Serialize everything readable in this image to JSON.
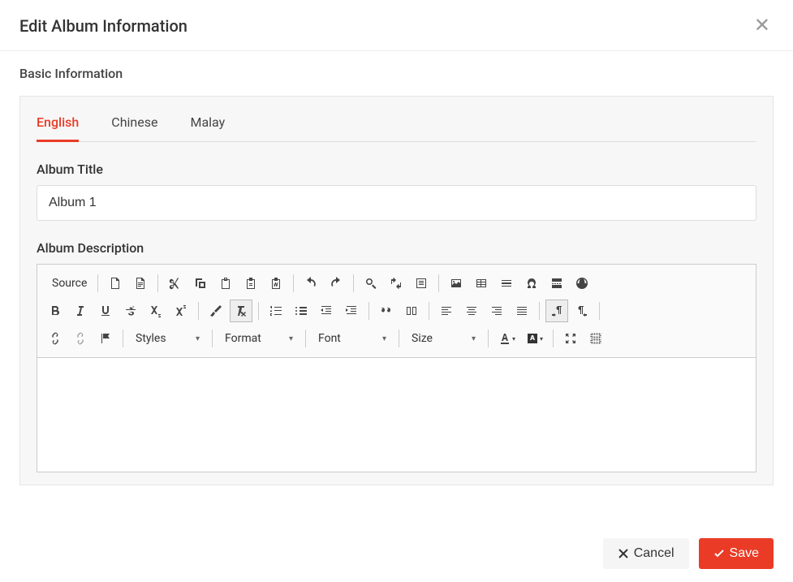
{
  "header": {
    "title": "Edit Album Information"
  },
  "section": {
    "title": "Basic Information"
  },
  "tabs": {
    "english": "English",
    "chinese": "Chinese",
    "malay": "Malay"
  },
  "fields": {
    "title_label": "Album Title",
    "title_value": "Album 1",
    "description_label": "Album Description"
  },
  "editor": {
    "source": "Source",
    "styles": "Styles",
    "format": "Format",
    "font": "Font",
    "size": "Size"
  },
  "footer": {
    "cancel": "Cancel",
    "save": "Save"
  }
}
